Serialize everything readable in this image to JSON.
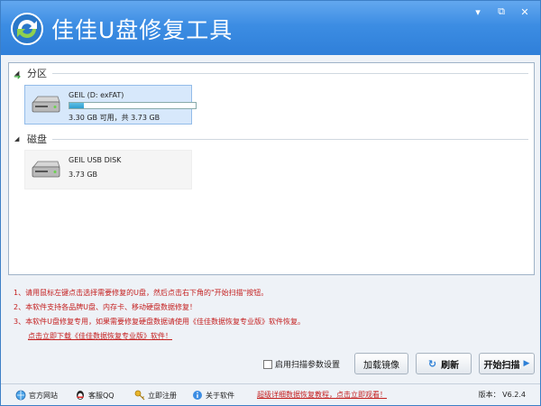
{
  "app": {
    "title": "佳佳U盘修复工具",
    "window_buttons": [
      "▾",
      "⧉",
      "✕"
    ]
  },
  "partitions": {
    "group_label": "分区",
    "items": [
      {
        "name": "GEIL (D: exFAT)",
        "size_text": "3.30 GB 可用，共 3.73 GB",
        "used_fraction": 0.115
      }
    ]
  },
  "disks": {
    "group_label": "磁盘",
    "items": [
      {
        "name": "GEIL USB DISK",
        "size_text": "3.73 GB"
      }
    ]
  },
  "notes": [
    "1、请用鼠标左键点击选择需要修复的U盘，然后点击右下角的\"开始扫描\"按钮。",
    "2、本软件支持各品牌U盘、内存卡、移动硬盘数据修复！",
    "3、本软件U盘修复专用，如果需要修复硬盘数据请使用《佳佳数据恢复专业版》软件恢复。"
  ],
  "download_link": "点击立即下载《佳佳数据恢复专业版》软件！",
  "actions": {
    "scan_settings_label": "启用扫描参数设置",
    "load_image_label": "加载镜像",
    "refresh_label": "刷新",
    "start_scan_label": "开始扫描"
  },
  "footer": {
    "website": "官方网站",
    "support_qq": "客服QQ",
    "register": "立即注册",
    "about": "关于软件",
    "tutorial": "超级详细数据恢复教程，点击立即观看！",
    "version": "版本： V6.2.4"
  },
  "colors": {
    "titlebar": "#3c8de3",
    "note_red": "#c41e1e",
    "selection": "#d7e8fb",
    "accent": "#2d7fd6"
  }
}
